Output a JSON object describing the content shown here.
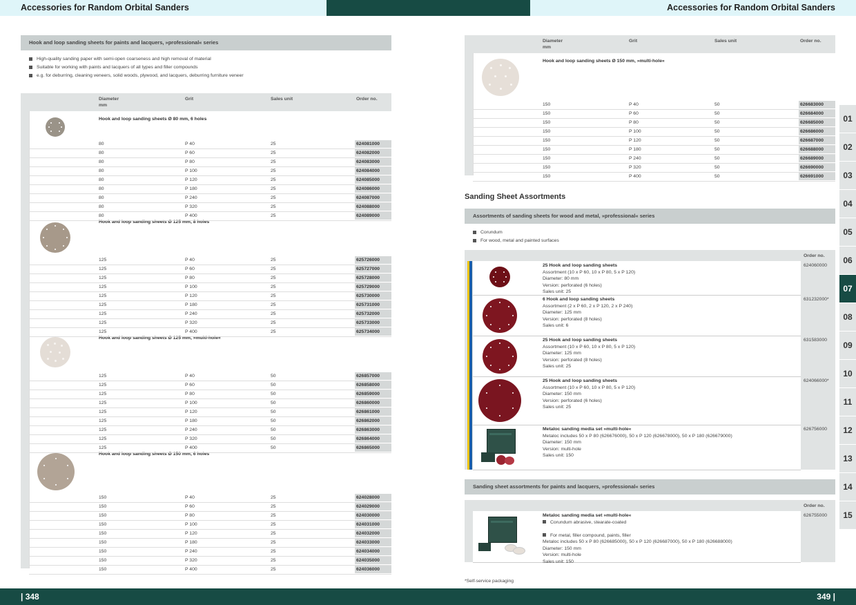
{
  "header": {
    "left_title": "Accessories for Random Orbital Sanders",
    "right_title": "Accessories for Random Orbital Sanders"
  },
  "footer": {
    "left_page": "| 348",
    "right_page": "349 |"
  },
  "left": {
    "section_title": "Hook and loop sanding sheets for paints and lacquers, »professional« series",
    "bullets": [
      "High-quality sanding paper with semi-open coarseness and high removal of material",
      "Suitable for working with paints and lacquers of all types and filler compounds",
      "e.g. for deburring, cleaning veneers, solid woods, plywood, and lacquers, deburring furniture veneer"
    ],
    "col_headers": {
      "diameter": "Diameter",
      "diameter_unit": "mm",
      "grit": "Grit",
      "sales_unit": "Sales unit",
      "order_no": "Order no."
    },
    "groups": [
      {
        "title": "Hook and loop sanding sheets Ø 80 mm, 6 holes",
        "rows": [
          [
            "80",
            "P 40",
            "25",
            "624081000"
          ],
          [
            "80",
            "P 60",
            "25",
            "624082000"
          ],
          [
            "80",
            "P 80",
            "25",
            "624083000"
          ],
          [
            "80",
            "P 100",
            "25",
            "624084000"
          ],
          [
            "80",
            "P 120",
            "25",
            "624085000"
          ],
          [
            "80",
            "P 180",
            "25",
            "624086000"
          ],
          [
            "80",
            "P 240",
            "25",
            "624087000"
          ],
          [
            "80",
            "P 320",
            "25",
            "624088000"
          ],
          [
            "80",
            "P 400",
            "25",
            "624089000"
          ]
        ]
      },
      {
        "title": "Hook and loop sanding sheets Ø 125 mm, 8 holes",
        "rows": [
          [
            "125",
            "P 40",
            "25",
            "625726000"
          ],
          [
            "125",
            "P 60",
            "25",
            "625727000"
          ],
          [
            "125",
            "P 80",
            "25",
            "625728000"
          ],
          [
            "125",
            "P 100",
            "25",
            "625729000"
          ],
          [
            "125",
            "P 120",
            "25",
            "625730000"
          ],
          [
            "125",
            "P 180",
            "25",
            "625731000"
          ],
          [
            "125",
            "P 240",
            "25",
            "625732000"
          ],
          [
            "125",
            "P 320",
            "25",
            "625733000"
          ],
          [
            "125",
            "P 400",
            "25",
            "625734000"
          ]
        ]
      },
      {
        "title": "Hook and loop sanding sheets Ø 125 mm, »multi-hole«",
        "rows": [
          [
            "125",
            "P 40",
            "50",
            "626857000"
          ],
          [
            "125",
            "P 60",
            "50",
            "626858000"
          ],
          [
            "125",
            "P 80",
            "50",
            "626859000"
          ],
          [
            "125",
            "P 100",
            "50",
            "626860000"
          ],
          [
            "125",
            "P 120",
            "50",
            "626861000"
          ],
          [
            "125",
            "P 180",
            "50",
            "626862000"
          ],
          [
            "125",
            "P 240",
            "50",
            "626863000"
          ],
          [
            "125",
            "P 320",
            "50",
            "626864000"
          ],
          [
            "125",
            "P 400",
            "50",
            "626865000"
          ]
        ]
      },
      {
        "title": "Hook and loop sanding sheets Ø 150 mm, 6 holes",
        "rows": [
          [
            "150",
            "P 40",
            "25",
            "624028000"
          ],
          [
            "150",
            "P 60",
            "25",
            "624029000"
          ],
          [
            "150",
            "P 80",
            "25",
            "624030000"
          ],
          [
            "150",
            "P 100",
            "25",
            "624031000"
          ],
          [
            "150",
            "P 120",
            "25",
            "624032000"
          ],
          [
            "150",
            "P 180",
            "25",
            "624033000"
          ],
          [
            "150",
            "P 240",
            "25",
            "624034000"
          ],
          [
            "150",
            "P 320",
            "25",
            "624035000"
          ],
          [
            "150",
            "P 400",
            "25",
            "624036000"
          ]
        ]
      }
    ]
  },
  "right": {
    "col_headers": {
      "diameter": "Diameter",
      "diameter_unit": "mm",
      "grit": "Grit",
      "sales_unit": "Sales unit",
      "order_no": "Order no."
    },
    "group": {
      "title": "Hook and loop sanding sheets Ø 150 mm, »multi-hole«",
      "rows": [
        [
          "150",
          "P 40",
          "50",
          "626683000"
        ],
        [
          "150",
          "P 60",
          "50",
          "626684000"
        ],
        [
          "150",
          "P 80",
          "50",
          "626685000"
        ],
        [
          "150",
          "P 100",
          "50",
          "626686000"
        ],
        [
          "150",
          "P 120",
          "50",
          "626687000"
        ],
        [
          "150",
          "P 180",
          "50",
          "626688000"
        ],
        [
          "150",
          "P 240",
          "50",
          "626689000"
        ],
        [
          "150",
          "P 320",
          "50",
          "626690000"
        ],
        [
          "150",
          "P 400",
          "50",
          "626691000"
        ]
      ]
    },
    "assortments_heading": "Sanding Sheet Assortments",
    "section1": {
      "title": "Assortments of sanding sheets for wood and metal, »professional« series",
      "bullets": [
        "Corundum",
        "For wood, metal and painted surfaces"
      ],
      "order_header": "Order no.",
      "items": [
        {
          "title": "25 Hook and loop sanding sheets",
          "lines": [
            "Assortment (10 x P 60, 10 x P 80, 5 x P 120)",
            "Diameter: 80 mm",
            "Version: perforated (6 holes)",
            "Sales unit: 25"
          ],
          "order": "624060000"
        },
        {
          "title": "6 Hook and loop sanding sheets",
          "lines": [
            "Assortment (2 x P 60, 2 x P 120, 2 x P 240)",
            "Diameter: 125 mm",
            "Version: perforated (8 holes)",
            "Sales unit: 6"
          ],
          "order": "631232000*"
        },
        {
          "title": "25 Hook and loop sanding sheets",
          "lines": [
            "Assortment (10 x P 60, 10 x P 80, 5 x P 120)",
            "Diameter: 125 mm",
            "Version: perforated (8 holes)",
            "Sales unit: 25"
          ],
          "order": "631583000"
        },
        {
          "title": "25 Hook and loop sanding sheets",
          "lines": [
            "Assortment (10 x P 60, 10 x P 80, 5 x P 120)",
            "Diameter: 150 mm",
            "Version: perforated (6 holes)",
            "Sales unit: 25"
          ],
          "order": "624066000*"
        },
        {
          "title": "Metaloc sanding media set »multi-hole«",
          "lines": [
            "Metaloc includes 50 x P 80 (626676000), 50 x P 120 (626678000), 50 x P 180 (626679000)",
            "Diameter: 150 mm",
            "Version: multi-hole",
            "Sales unit: 150"
          ],
          "order": "626756000"
        }
      ]
    },
    "section2": {
      "title": "Sanding sheet assortments for paints and lacquers, »professional« series",
      "order_header": "Order no.",
      "item": {
        "title": "Metaloc sanding media set »multi-hole«",
        "bullets": [
          "Corundum abrasive, stearate-coated",
          "For metal, filler compound, paints, filler"
        ],
        "lines": [
          "Metaloc includes 50 x P 80 (626685000), 50 x P 120 (626687000), 50 x P 180 (626688000)",
          "Diameter: 150 mm",
          "Version: multi-hole",
          "Sales unit: 150"
        ],
        "order": "626755000"
      }
    },
    "footnote": "*Self-service packaging"
  },
  "tabs": [
    "01",
    "02",
    "03",
    "04",
    "05",
    "06",
    "07",
    "08",
    "09",
    "10",
    "11",
    "12",
    "13",
    "14",
    "15"
  ],
  "active_tab": "07",
  "colors": {
    "dark_green": "#174b44",
    "light_cyan": "#dff5f9",
    "section_grey": "#c9cfcf",
    "sheet_red": "#8a1a22"
  }
}
